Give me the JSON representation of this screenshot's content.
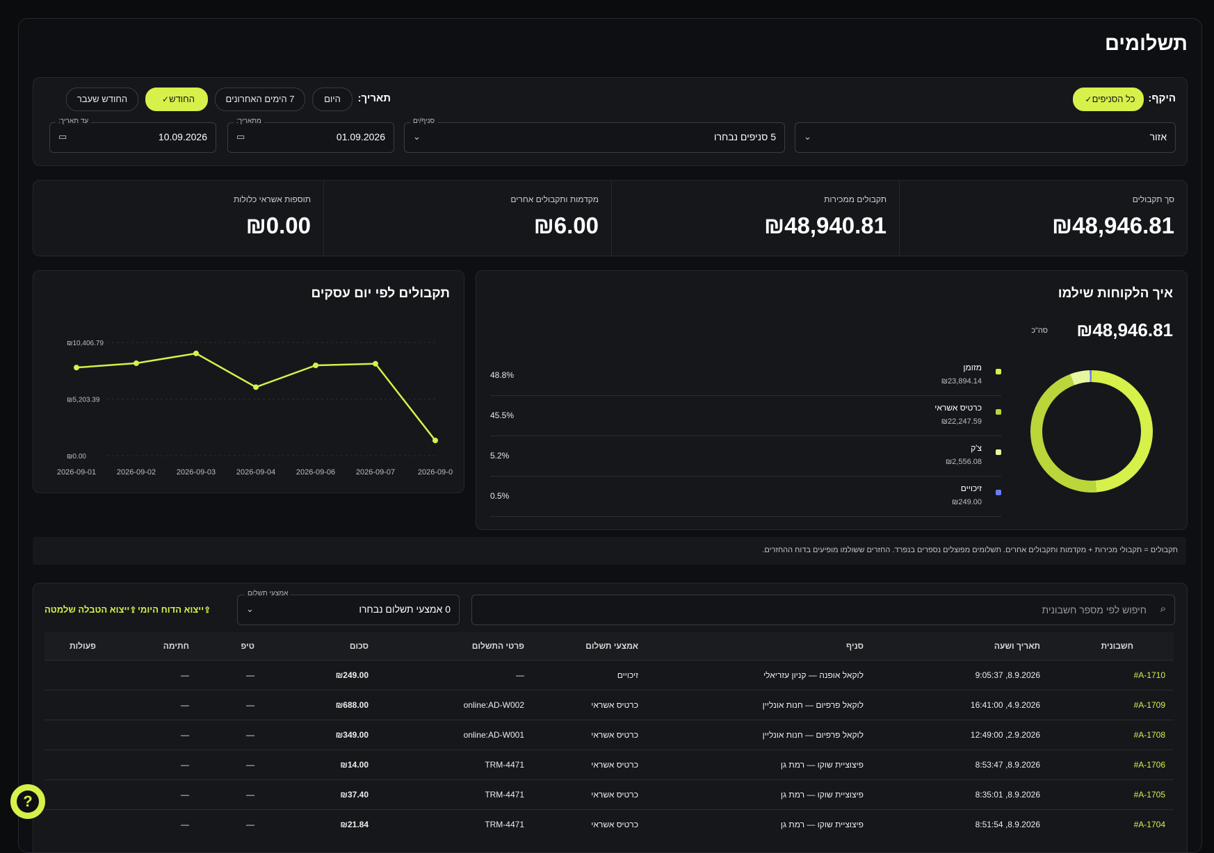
{
  "page": {
    "title": "תשלומים"
  },
  "filters": {
    "scope_label": "היקף:",
    "scope_all": "כל הסניפים",
    "date_label": "תאריך:",
    "date_today": "היום",
    "date_7days": "7 הימים האחרונים",
    "date_this_month": "החודש",
    "date_last_month": "החודש שעבר",
    "region_value": "אזור",
    "branches_label": "סניף/ים",
    "branches_value": "5 סניפים נבחרו",
    "from_label": "מתאריך:",
    "from_value": "01.09.2026",
    "to_label": "עד תאריך:",
    "to_value": "10.09.2026",
    "check_icon": "check-icon",
    "calendar_icon": "calendar-icon",
    "chevron_icon": "chevron-down-icon"
  },
  "stats": {
    "total_receipts_label": "סך תקבולים",
    "total_receipts_value": "₪48,946.81",
    "sales_receipts_label": "תקבולים ממכירות",
    "sales_receipts_value": "₪48,940.81",
    "advances_label": "מקדמות ותקבולים אחרים",
    "advances_value": "₪6.00",
    "credit_surcharges_label": "תוספות אשראי כלולות",
    "credit_surcharges_value": "₪0.00"
  },
  "payments": {
    "title": "איך הלקוחות שילמו",
    "total_value": "₪48,946.81",
    "total_label": "סה\"כ",
    "methods": [
      {
        "name": "מזומן",
        "amount": "₪23,894.14",
        "pct": "48.8%",
        "share": 48.8,
        "color": "#d7f04a"
      },
      {
        "name": "כרטיס אשראי",
        "amount": "₪22,247.59",
        "pct": "45.5%",
        "share": 45.5,
        "color": "#b9d63a"
      },
      {
        "name": "צ'ק",
        "amount": "₪2,556.08",
        "pct": "5.2%",
        "share": 5.2,
        "color": "#e7f7a0"
      },
      {
        "name": "זיכויים",
        "amount": "₪249.00",
        "pct": "0.5%",
        "share": 0.5,
        "color": "#6b7cf5"
      }
    ]
  },
  "daily": {
    "title": "תקבולים לפי יום עסקים",
    "y_ticks": [
      "₪10,406.79",
      "₪5,203.39",
      "₪0.00"
    ]
  },
  "chart_data": {
    "type": "line",
    "title": "תקבולים לפי יום עסקים",
    "x": [
      "2026-09-01",
      "2026-09-02",
      "2026-09-03",
      "2026-09-04",
      "2026-09-06",
      "2026-09-07",
      "2026-09-0"
    ],
    "series": [
      {
        "values": [
          8100,
          8500,
          9400,
          6300,
          8300,
          8450,
          1400
        ]
      }
    ],
    "ylim": [
      0,
      10406.79
    ],
    "y_ticks": [
      0,
      5203.39,
      10406.79
    ],
    "grid": true,
    "color": "#d7f04a"
  },
  "note": "תקבולים = תקבולי מכירות + מקדמות ותקבולים אחרים. תשלומים מפוצלים נספרים בנפרד. החזרים ששולמו מופיעים בדוח ההחזרים.",
  "table": {
    "search_placeholder": "חיפוש לפי מספר חשבונית",
    "payment_method_label": "אמצעי תשלום",
    "payment_method_value": "0 אמצעי תשלום נבחרו",
    "export_daily": "ייצוא הדוח היומי",
    "export_full": "ייצוא הטבלה שלמטה",
    "upload_icon": "upload-icon",
    "columns": [
      "חשבונית",
      "תאריך ושעה",
      "סניף",
      "אמצעי תשלום",
      "פרטי התשלום",
      "סכום",
      "טיפ",
      "חתימה",
      "פעולות"
    ],
    "rows": [
      {
        "invoice": "#A-1710",
        "datetime": "8.9.2026, 9:05:37",
        "branch": "לוקאל אופנה — קניון עזריאלי",
        "method": "זיכויים",
        "details": "—",
        "amount": "₪249.00",
        "tip": "—",
        "signature": "—",
        "actions": ""
      },
      {
        "invoice": "#A-1709",
        "datetime": "4.9.2026, 16:41:00",
        "branch": "לוקאל פרפיום — חנות אונליין",
        "method": "כרטיס אשראי",
        "details": "online:AD-W002",
        "amount": "₪688.00",
        "tip": "—",
        "signature": "—",
        "actions": ""
      },
      {
        "invoice": "#A-1708",
        "datetime": "2.9.2026, 12:49:00",
        "branch": "לוקאל פרפיום — חנות אונליין",
        "method": "כרטיס אשראי",
        "details": "online:AD-W001",
        "amount": "₪349.00",
        "tip": "—",
        "signature": "—",
        "actions": ""
      },
      {
        "invoice": "#A-1706",
        "datetime": "8.9.2026, 8:53:47",
        "branch": "פיצוציית שוקו — רמת גן",
        "method": "כרטיס אשראי",
        "details": "TRM-4471",
        "amount": "₪14.00",
        "tip": "—",
        "signature": "—",
        "actions": ""
      },
      {
        "invoice": "#A-1705",
        "datetime": "8.9.2026, 8:35:01",
        "branch": "פיצוציית שוקו — רמת גן",
        "method": "כרטיס אשראי",
        "details": "TRM-4471",
        "amount": "₪37.40",
        "tip": "—",
        "signature": "—",
        "actions": ""
      },
      {
        "invoice": "#A-1704",
        "datetime": "8.9.2026, 8:51:54",
        "branch": "פיצוציית שוקו — רמת גן",
        "method": "כרטיס אשראי",
        "details": "TRM-4471",
        "amount": "₪21.84",
        "tip": "—",
        "signature": "—",
        "actions": ""
      }
    ]
  },
  "help": {
    "icon": "help-icon",
    "glyph": "?"
  }
}
